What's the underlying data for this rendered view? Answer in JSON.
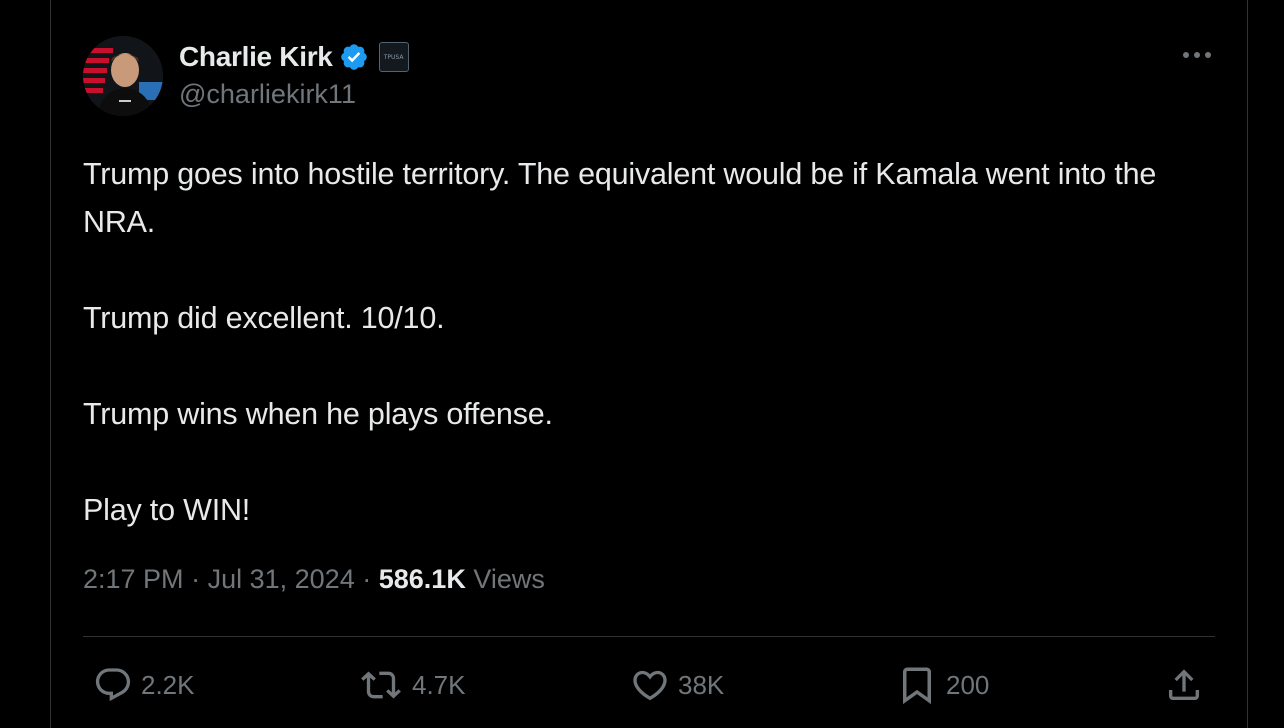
{
  "author": {
    "display_name": "Charlie Kirk",
    "handle": "@charliekirk11",
    "verified": true,
    "affiliate_badge_text": "TPUSA"
  },
  "tweet": {
    "paragraphs": [
      "Trump goes into hostile territory. The equivalent would be if Kamala went into the NRA.",
      "Trump did excellent. 10/10.",
      "Trump wins when he plays offense.",
      "Play to WIN!"
    ],
    "time": "2:17 PM",
    "date": "Jul 31, 2024",
    "views_count": "586.1K",
    "views_label": "Views",
    "separator": "·"
  },
  "actions": {
    "replies": "2.2K",
    "reposts": "4.7K",
    "likes": "38K",
    "bookmarks": "200"
  },
  "icons": {
    "verified": "verified-badge-icon",
    "more": "more-options-icon",
    "reply": "reply-icon",
    "repost": "repost-icon",
    "like": "heart-icon",
    "bookmark": "bookmark-icon",
    "share": "share-icon"
  },
  "colors": {
    "background": "#000000",
    "text_primary": "#e7e9ea",
    "text_secondary": "#71767b",
    "verified_blue": "#1d9bf0",
    "divider": "#2f3336"
  }
}
